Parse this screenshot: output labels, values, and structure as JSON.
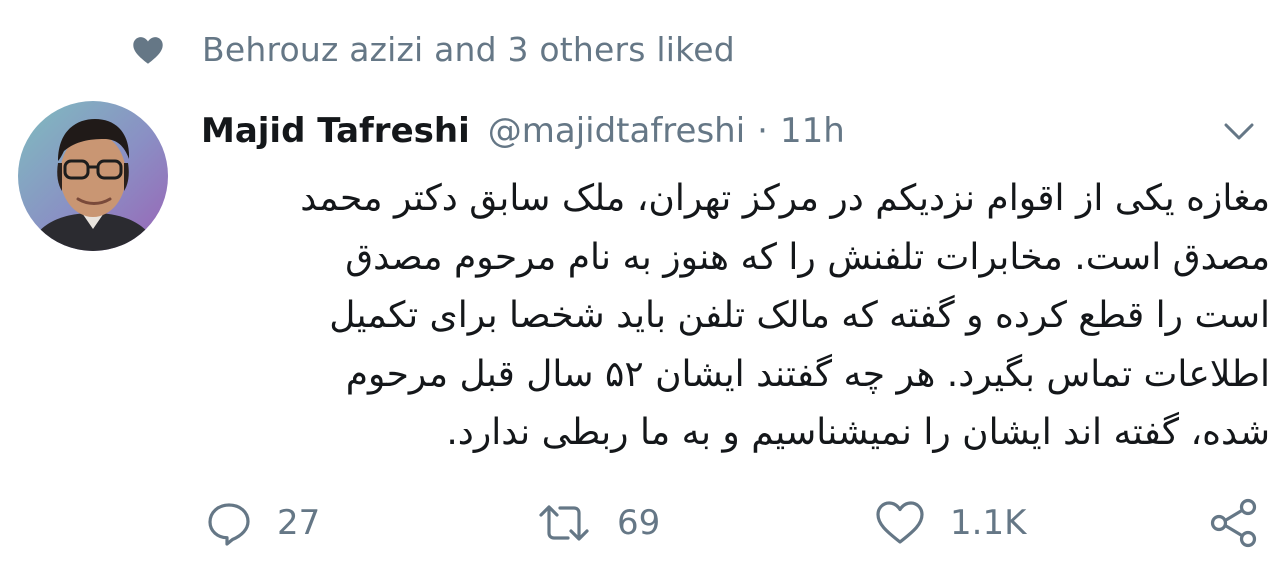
{
  "social_context": {
    "icon": "heart-icon",
    "text": "Behrouz azizi and 3 others liked"
  },
  "tweet": {
    "author_name": "Majid Tafreshi",
    "handle": "@majidtafreshi",
    "separator": "·",
    "time": "11h",
    "body_lines": [
      "مغازه یکی از اقوام نزدیکم در مرکز تهران، ملک سابق دکتر محمد",
      "مصدق است. مخابرات تلفنش را که هنوز به نام مرحوم مصدق",
      "است را قطع کرده و گفته که مالک تلفن باید شخصا برای تکمیل",
      "اطلاعات تماس بگیرد. هر چه گفتند ایشان ۵۲ سال قبل مرحوم",
      "شده، گفته اند ایشان را نمیشناسیم و به ما ربطی ندارد."
    ]
  },
  "actions": {
    "reply_count": "27",
    "retweet_count": "69",
    "like_count": "1.1K"
  },
  "colors": {
    "text": "#14171a",
    "secondary": "#657786",
    "background": "#ffffff"
  }
}
